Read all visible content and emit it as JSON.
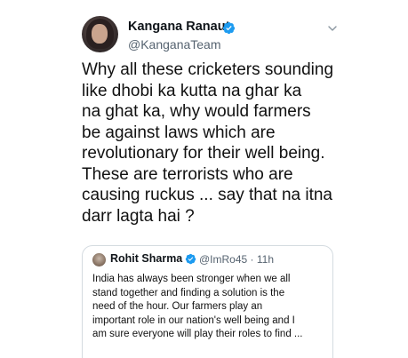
{
  "tweet": {
    "author": {
      "display_name": "Kangana Ranaut",
      "handle": "@KanganaTeam",
      "verified_icon": "verified-badge-icon",
      "avatar": "profile-photo"
    },
    "menu_icon": "chevron-down-icon",
    "text_lines": [
      "Why all these cricketers sounding",
      "like dhobi ka kutta na ghar ka",
      "na ghat ka, why would farmers",
      "be against laws which are",
      "revolutionary for their well being.",
      "These are terrorists who are",
      "causing ruckus ... say that na itna",
      "darr lagta hai ?"
    ]
  },
  "quoted_tweet": {
    "display_name": "Rohit Sharma",
    "handle": "@ImRo45",
    "separator": "·",
    "time": "11h",
    "verified_icon": "verified-badge-icon",
    "text_lines": [
      "India has always been stronger when we all",
      "stand together and finding a solution is the",
      "need of the hour. Our farmers play an",
      "important role in our nation's well being and I",
      "am sure everyone will play their roles to find ..."
    ]
  },
  "colors": {
    "verified": "#1d9bf0",
    "secondary_text": "#566370",
    "border": "#d4dbe0"
  }
}
